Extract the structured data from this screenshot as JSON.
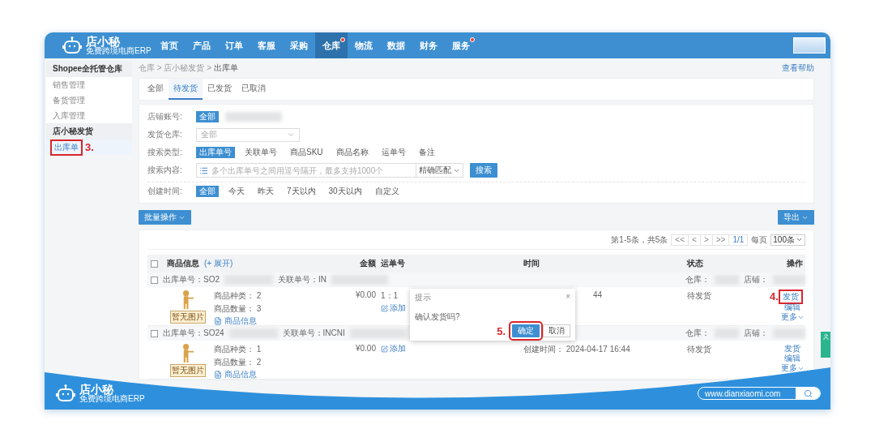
{
  "brand": {
    "name": "店小秘",
    "tagline": "免费跨境电商ERP"
  },
  "nav": [
    {
      "label": "首页",
      "selected": false,
      "badge": false
    },
    {
      "label": "产品",
      "selected": false,
      "badge": false
    },
    {
      "label": "订单",
      "selected": false,
      "badge": false
    },
    {
      "label": "客服",
      "selected": false,
      "badge": false
    },
    {
      "label": "采购",
      "selected": false,
      "badge": false
    },
    {
      "label": "仓库",
      "selected": true,
      "badge": true
    },
    {
      "label": "物流",
      "selected": false,
      "badge": false
    },
    {
      "label": "数据",
      "selected": false,
      "badge": false
    },
    {
      "label": "财务",
      "selected": false,
      "badge": false
    },
    {
      "label": "服务",
      "selected": false,
      "badge": true
    }
  ],
  "sidebar": [
    {
      "title": "Shopee全托管仓库",
      "items": [
        {
          "label": "销售管理",
          "selected": false
        },
        {
          "label": "备货管理",
          "selected": false
        },
        {
          "label": "入库管理",
          "selected": false
        }
      ]
    },
    {
      "title": "店小秘发货",
      "items": [
        {
          "label": "出库单",
          "selected": true,
          "step": "3."
        }
      ]
    }
  ],
  "breadcrumb": "仓库 > 店小秘发货 > **出库单**",
  "help_link": "查看帮助",
  "status_tabs": [
    {
      "label": "全部",
      "selected": false
    },
    {
      "label": "待发货",
      "selected": true
    },
    {
      "label": "已发货",
      "selected": false
    },
    {
      "label": "已取消",
      "selected": false
    }
  ],
  "filters": [
    {
      "kind": "chips",
      "label": "店铺账号:",
      "redacted": true,
      "options": [
        {
          "label": "全部",
          "selected": true
        }
      ]
    },
    {
      "kind": "select",
      "label": "发货仓库:",
      "value": "全部"
    },
    {
      "kind": "chips",
      "label": "搜索类型:",
      "options": [
        {
          "label": "出库单号",
          "selected": true
        },
        {
          "label": "关联单号",
          "selected": false
        },
        {
          "label": "商品SKU",
          "selected": false
        },
        {
          "label": "商品名称",
          "selected": false
        },
        {
          "label": "运单号",
          "selected": false
        },
        {
          "label": "备注",
          "selected": false
        }
      ]
    },
    {
      "kind": "search",
      "label": "搜索内容:",
      "placeholder": "多个出库单号之间用逗号隔开，最多支持1000个",
      "match": "精确匹配",
      "button": "搜索"
    },
    {
      "kind": "chips",
      "label": "创建时间:",
      "options": [
        {
          "label": "全部",
          "selected": true
        },
        {
          "label": "今天",
          "selected": false
        },
        {
          "label": "昨天",
          "selected": false
        },
        {
          "label": "7天以内",
          "selected": false
        },
        {
          "label": "30天以内",
          "selected": false
        },
        {
          "label": "自定义",
          "selected": false
        }
      ]
    }
  ],
  "bulk_button": "批量操作",
  "export_button": "导出",
  "pagination": {
    "summary": "第1-5条，共5条",
    "first": "<<",
    "prev": "<",
    "next": ">",
    "last": ">>",
    "page": "1/1",
    "per_page_label": "每页",
    "per_page": "100条"
  },
  "table": {
    "all_checked": false,
    "columns": [
      {
        "label": "商品信息",
        "link": "(+ 展开)"
      },
      {
        "label": "金额"
      },
      {
        "label": "运单号"
      },
      {
        "label": "时间"
      },
      {
        "label": "状态"
      },
      {
        "label": "操作"
      }
    ],
    "orders": [
      {
        "checked": false,
        "order_no": "出库单号：SO2",
        "related": "关联单号：IN",
        "warehouse": "仓库：",
        "shop": "店铺：",
        "image": "暂无图片",
        "types": "商品种类：  2",
        "qty": "商品数量：  3",
        "info": "商品信息",
        "amount": "¥0.00",
        "waybill": "1：1",
        "add": "添加",
        "time": "44",
        "status": "待发货",
        "actions": [
          {
            "kind": "link",
            "label": "发货",
            "step": "4."
          },
          {
            "kind": "link",
            "label": "编辑"
          },
          {
            "kind": "menu",
            "label": "更多"
          }
        ]
      },
      {
        "checked": false,
        "order_no": "出库单号：SO24",
        "related": "关联单号：INCNI",
        "warehouse": "仓库：",
        "shop": "店铺：",
        "image": "暂无图片",
        "types": "商品种类：  1",
        "qty": "商品数量：  2",
        "info": "商品信息",
        "amount": "¥0.00",
        "add": "添加",
        "time": "创建时间：  2024-04-17 16:44",
        "status": "待发货",
        "actions": [
          {
            "kind": "link",
            "label": "发货"
          },
          {
            "kind": "link",
            "label": "编辑"
          },
          {
            "kind": "menu",
            "label": "更多"
          }
        ]
      }
    ]
  },
  "dialog": {
    "title": "提示",
    "close": "×",
    "message": "确认发货吗?",
    "confirm": "确定",
    "cancel": "取消",
    "step": "5."
  },
  "footer": {
    "brand": {
      "name": "店小秘",
      "tagline": "免费跨境电商ERP"
    },
    "url": "www.dianxiaomi.com"
  }
}
